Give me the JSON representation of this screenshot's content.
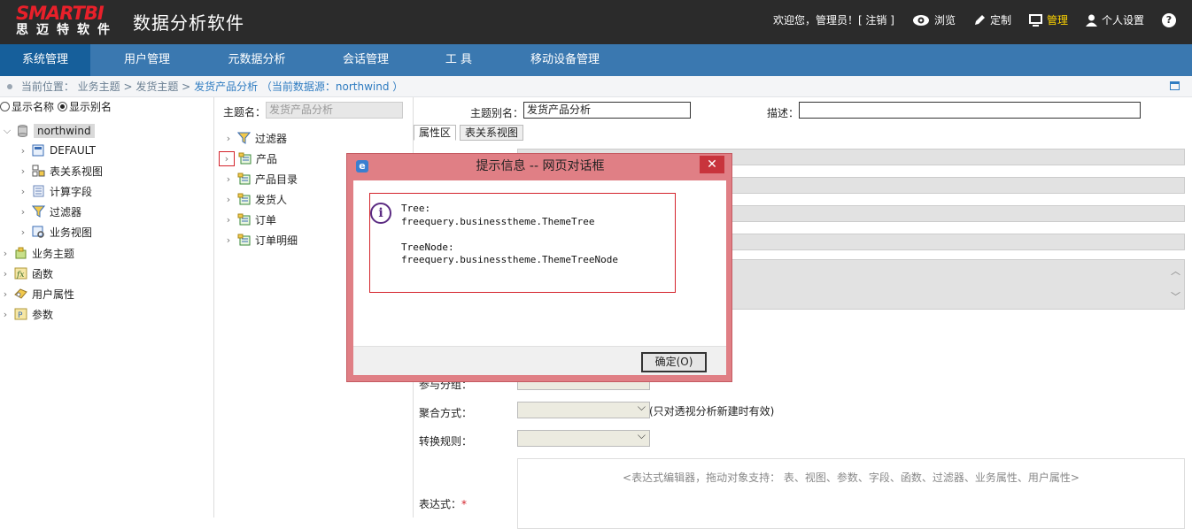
{
  "header": {
    "logo_top": "SMARTBI",
    "logo_bottom": "思迈特软件",
    "app_title": "数据分析软件",
    "welcome": "欢迎您，管理员！[ 注销 ]",
    "nav": [
      {
        "label": "浏览",
        "icon": "eye-icon"
      },
      {
        "label": "定制",
        "icon": "pencil-icon"
      },
      {
        "label": "管理",
        "icon": "monitor-icon",
        "active": true
      },
      {
        "label": "个人设置",
        "icon": "user-icon"
      }
    ],
    "help": "?"
  },
  "menu": [
    "系统管理",
    "用户管理",
    "元数据分析",
    "会话管理",
    "工 具",
    "移动设备管理"
  ],
  "breadcrumb": {
    "prefix": "当前位置：",
    "path": "业务主题 > 发货主题 >",
    "current": "发货产品分析 （当前数据源：northwind ）"
  },
  "left": {
    "radio_name": "显示名称",
    "radio_alias": "显示别名",
    "root": "northwind",
    "children": [
      "DEFAULT",
      "表关系视图",
      "计算字段",
      "过滤器",
      "业务视图"
    ],
    "top": [
      "业务主题",
      "函数",
      "用户属性",
      "参数"
    ]
  },
  "middle": {
    "theme_label": "主题名：",
    "theme_value": "发货产品分析",
    "nodes": [
      "过滤器",
      "产品",
      "产品目录",
      "发货人",
      "订单",
      "订单明细"
    ]
  },
  "right": {
    "alias_label": "主题别名：",
    "alias_value": "发货产品分析",
    "desc_label": "描述：",
    "tab_props": "属性区",
    "tab_rel": "表关系视图",
    "group_label": "参与分组：",
    "agg_label": "聚合方式：",
    "agg_note": "(只对透视分析新建时有效)",
    "conv_label": "转换规则：",
    "expr_label": "表达式：",
    "expr_required": "*",
    "expr_hint": "<表达式编辑器，拖动对象支持：  表、视图、参数、字段、函数、过滤器、业务属性、用户属性>"
  },
  "dialog": {
    "title": "提示信息 -- 网页对话框",
    "close": "✕",
    "ie_icon": "e",
    "info_icon": "i",
    "message": "Tree:\nfreequery.businesstheme.ThemeTree\n\nTreeNode:\nfreequery.businesstheme.ThemeTreeNode",
    "ok": "确定(O)"
  }
}
